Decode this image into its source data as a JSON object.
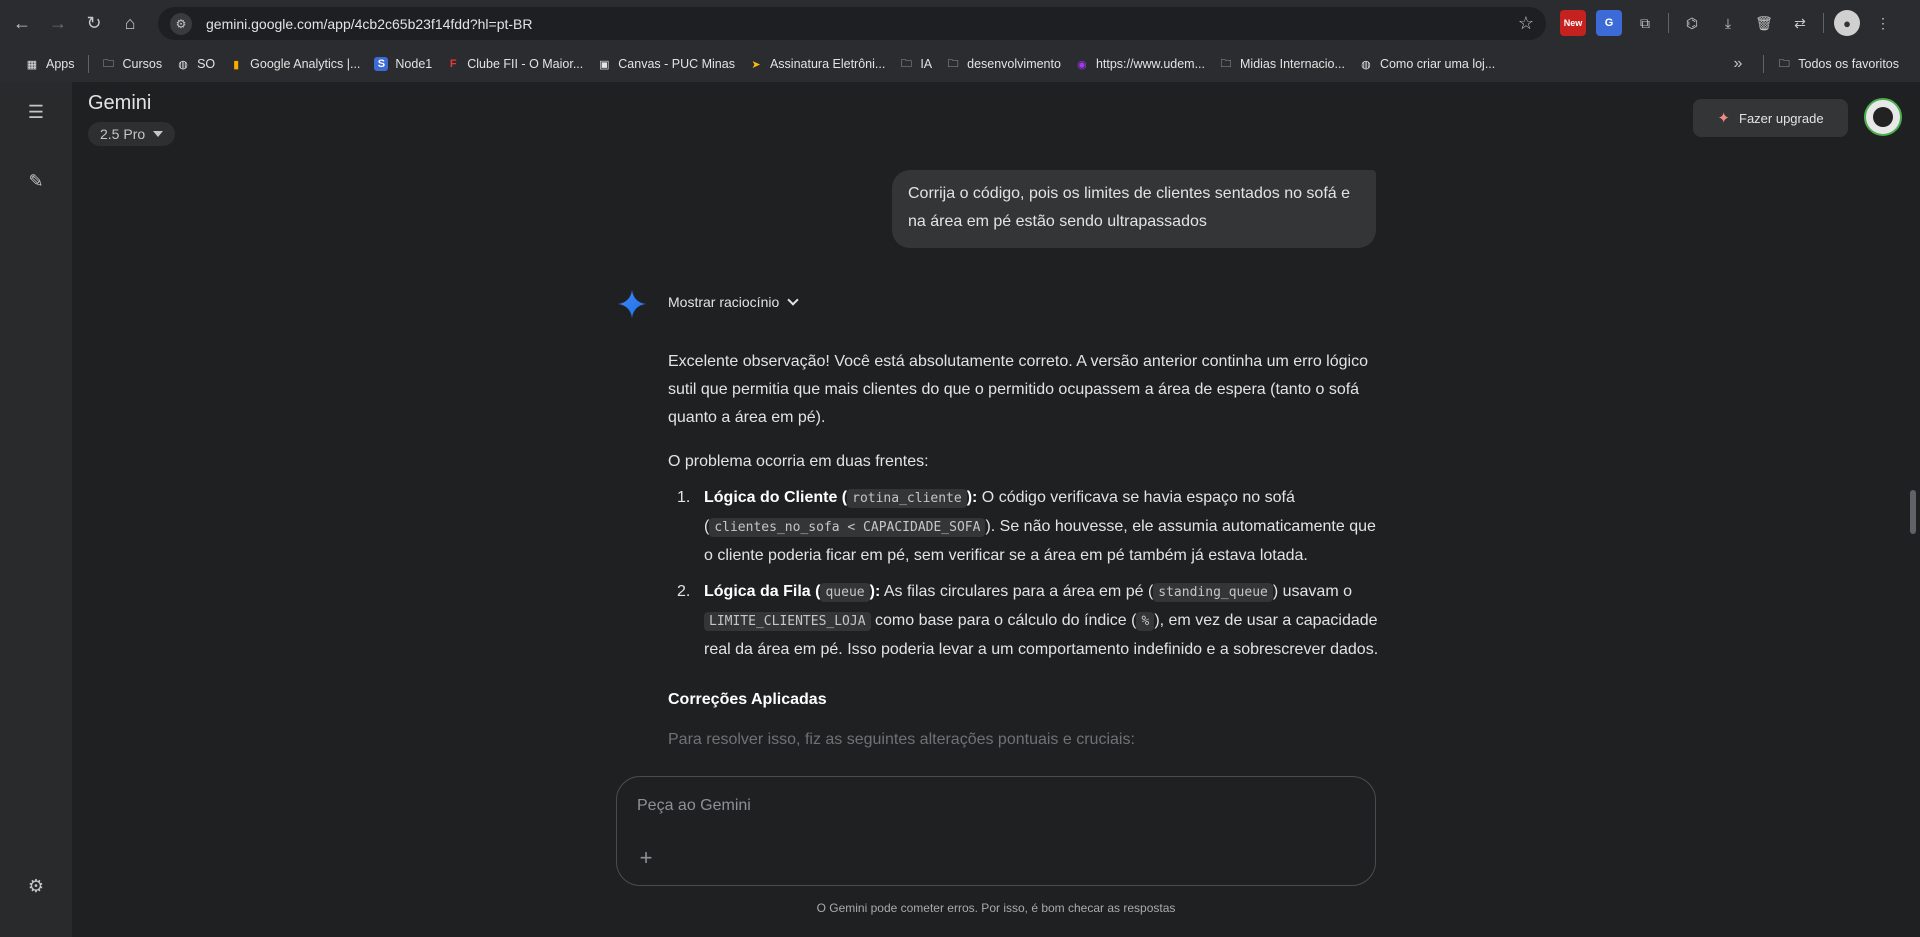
{
  "browser": {
    "url": "gemini.google.com/app/4cb2c65b23f14fdd?hl=pt-BR",
    "bookmarks": [
      {
        "label": "Apps",
        "icon": "apps-grid-icon"
      },
      {
        "label": "Cursos",
        "icon": "folder-icon"
      },
      {
        "label": "SO",
        "icon": "globe-icon"
      },
      {
        "label": "Google Analytics |...",
        "icon": "analytics-icon"
      },
      {
        "label": "Node1",
        "icon": "s-icon"
      },
      {
        "label": "Clube FII - O Maior...",
        "icon": "f-icon"
      },
      {
        "label": "Canvas - PUC Minas",
        "icon": "canvas-icon"
      },
      {
        "label": "Assinatura Eletrôni...",
        "icon": "arrow-icon"
      },
      {
        "label": "IA",
        "icon": "folder-icon"
      },
      {
        "label": "desenvolvimento",
        "icon": "folder-icon"
      },
      {
        "label": "https://www.udem...",
        "icon": "udemy-icon"
      },
      {
        "label": "Midias Internacio...",
        "icon": "folder-icon"
      },
      {
        "label": "Como criar uma loj...",
        "icon": "globe-icon"
      }
    ],
    "all_bookmarks": "Todos os favoritos",
    "ext_new_badge": "New",
    "ext_translate": "G"
  },
  "app": {
    "title": "Gemini",
    "model": "2.5 Pro",
    "upgrade_label": "Fazer upgrade"
  },
  "conversation": {
    "user_message": "Corrija o código, pois os limites de clientes sentados no sofá e na área em pé estão sendo ultrapassados",
    "reasoning_label": "Mostrar raciocínio",
    "intro": "Excelente observação! Você está absolutamente correto. A versão anterior continha um erro lógico sutil que permitia que mais clientes do que o permitido ocupassem a área de espera (tanto o sofá quanto a área em pé).",
    "problem_lead": "O problema ocorria em duas frentes:",
    "item1": {
      "num": "1.",
      "bold_a": "Lógica do Cliente (",
      "code_a": "rotina_cliente",
      "bold_b": "):",
      "text_a": " O código verificava se havia espaço no sofá (",
      "code_b": "clientes_no_sofa < CAPACIDADE_SOFA",
      "text_b": "). Se não houvesse, ele assumia automaticamente que o cliente poderia ficar em pé, sem verificar se a área em pé também já estava lotada."
    },
    "item2": {
      "num": "2.",
      "bold_a": "Lógica da Fila (",
      "code_a": "queue",
      "bold_b": "):",
      "text_a": " As filas circulares para a área em pé (",
      "code_b": "standing_queue",
      "text_b": ") usavam o ",
      "code_c": "LIMITE_CLIENTES_LOJA",
      "text_c": " como base para o cálculo do índice (",
      "code_d": "%",
      "text_d": "), em vez de usar a capacidade real da área em pé. Isso poderia levar a um comportamento indefinido e a sobrescrever dados."
    },
    "section_heading": "Correções Aplicadas",
    "section_lead": "Para resolver isso, fiz as seguintes alterações pontuais e cruciais:"
  },
  "composer": {
    "placeholder": "Peça ao Gemini"
  },
  "footer": {
    "disclaimer": "O Gemini pode cometer erros. Por isso, é bom checar as respostas"
  },
  "colors": {
    "background": "#1f2022",
    "rail": "#282a2c",
    "bubble": "#333537",
    "accent_star": "#4285f4"
  }
}
